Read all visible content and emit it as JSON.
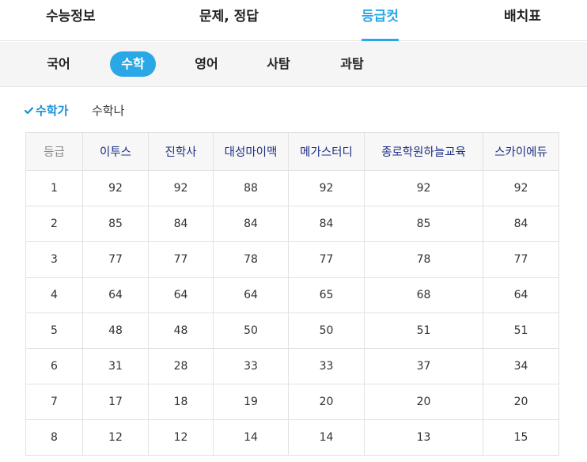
{
  "top_tabs": [
    {
      "label": "수능정보"
    },
    {
      "label": "문제, 정답"
    },
    {
      "label": "등급컷"
    },
    {
      "label": "배치표"
    }
  ],
  "sub_tabs": [
    {
      "label": "국어"
    },
    {
      "label": "수학"
    },
    {
      "label": "영어"
    },
    {
      "label": "사탐"
    },
    {
      "label": "과탐"
    }
  ],
  "math_toggle": {
    "selected": "수학가",
    "other": "수학나"
  },
  "table": {
    "headers": [
      "등급",
      "이투스",
      "진학사",
      "대성마이맥",
      "메가스터디",
      "종로학원하늘교육",
      "스카이에듀"
    ],
    "rows": [
      [
        "1",
        "92",
        "92",
        "88",
        "92",
        "92",
        "92"
      ],
      [
        "2",
        "85",
        "84",
        "84",
        "84",
        "85",
        "84"
      ],
      [
        "3",
        "77",
        "77",
        "78",
        "77",
        "78",
        "77"
      ],
      [
        "4",
        "64",
        "64",
        "64",
        "65",
        "68",
        "64"
      ],
      [
        "5",
        "48",
        "48",
        "50",
        "50",
        "51",
        "51"
      ],
      [
        "6",
        "31",
        "28",
        "33",
        "33",
        "37",
        "34"
      ],
      [
        "7",
        "17",
        "18",
        "19",
        "20",
        "20",
        "20"
      ],
      [
        "8",
        "12",
        "12",
        "14",
        "14",
        "13",
        "15"
      ]
    ]
  },
  "colors": {
    "accent": "#2aa8e6",
    "header_text": "#1c2f86",
    "check": "#1a8fd6"
  }
}
